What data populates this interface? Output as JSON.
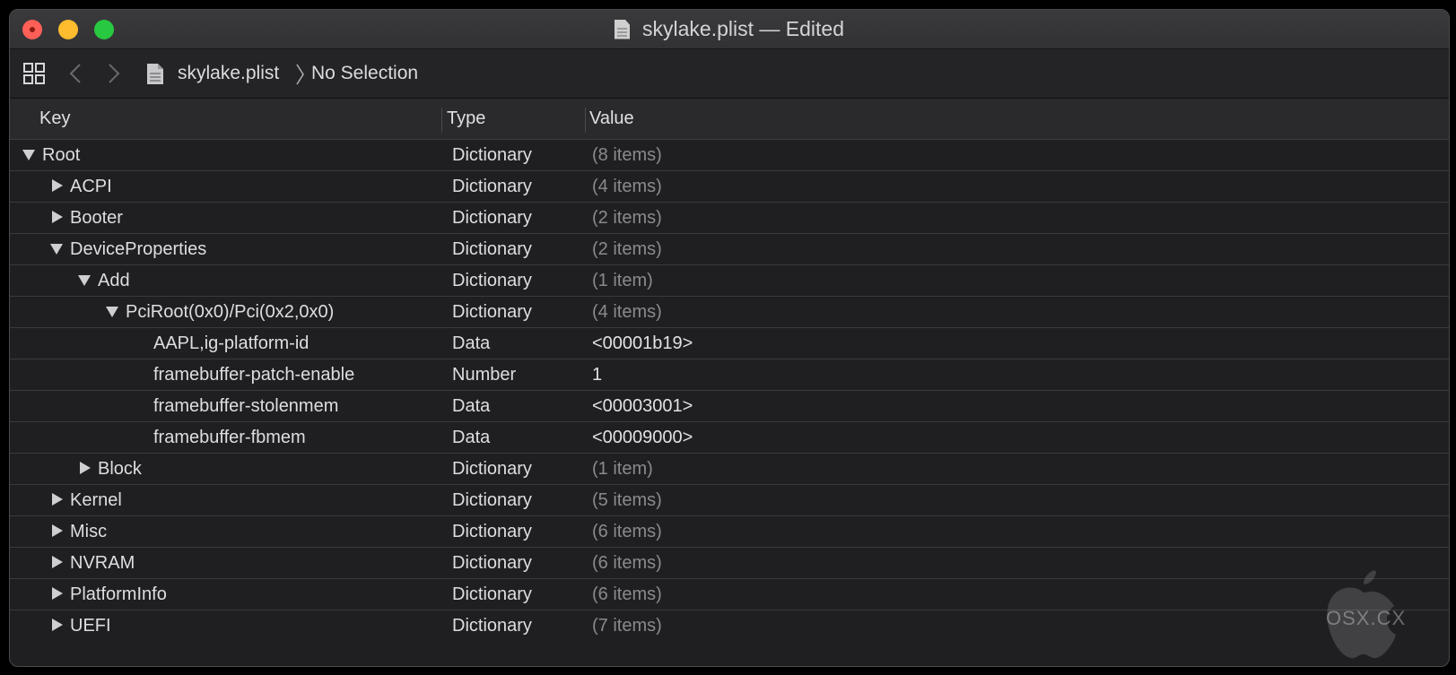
{
  "window": {
    "title": "skylake.plist — Edited"
  },
  "toolbar": {
    "file_name": "skylake.plist",
    "selection": "No Selection"
  },
  "columns": {
    "key": "Key",
    "type": "Type",
    "value": "Value"
  },
  "rows": [
    {
      "key": "Root",
      "depth": 0,
      "disclosure": "expanded",
      "type": "Dictionary",
      "value": "(8 items)",
      "container": true
    },
    {
      "key": "ACPI",
      "depth": 1,
      "disclosure": "collapsed",
      "type": "Dictionary",
      "value": "(4 items)",
      "container": true
    },
    {
      "key": "Booter",
      "depth": 1,
      "disclosure": "collapsed",
      "type": "Dictionary",
      "value": "(2 items)",
      "container": true
    },
    {
      "key": "DeviceProperties",
      "depth": 1,
      "disclosure": "expanded",
      "type": "Dictionary",
      "value": "(2 items)",
      "container": true
    },
    {
      "key": "Add",
      "depth": 2,
      "disclosure": "expanded",
      "type": "Dictionary",
      "value": "(1 item)",
      "container": true
    },
    {
      "key": "PciRoot(0x0)/Pci(0x2,0x0)",
      "depth": 3,
      "disclosure": "expanded",
      "type": "Dictionary",
      "value": "(4 items)",
      "container": true
    },
    {
      "key": "AAPL,ig-platform-id",
      "depth": 4,
      "disclosure": "none",
      "type": "Data",
      "value": "<00001b19>",
      "container": false
    },
    {
      "key": "framebuffer-patch-enable",
      "depth": 4,
      "disclosure": "none",
      "type": "Number",
      "value": "1",
      "container": false
    },
    {
      "key": "framebuffer-stolenmem",
      "depth": 4,
      "disclosure": "none",
      "type": "Data",
      "value": "<00003001>",
      "container": false
    },
    {
      "key": "framebuffer-fbmem",
      "depth": 4,
      "disclosure": "none",
      "type": "Data",
      "value": "<00009000>",
      "container": false
    },
    {
      "key": "Block",
      "depth": 2,
      "disclosure": "collapsed",
      "type": "Dictionary",
      "value": "(1 item)",
      "container": true
    },
    {
      "key": "Kernel",
      "depth": 1,
      "disclosure": "collapsed",
      "type": "Dictionary",
      "value": "(5 items)",
      "container": true
    },
    {
      "key": "Misc",
      "depth": 1,
      "disclosure": "collapsed",
      "type": "Dictionary",
      "value": "(6 items)",
      "container": true
    },
    {
      "key": "NVRAM",
      "depth": 1,
      "disclosure": "collapsed",
      "type": "Dictionary",
      "value": "(6 items)",
      "container": true
    },
    {
      "key": "PlatformInfo",
      "depth": 1,
      "disclosure": "collapsed",
      "type": "Dictionary",
      "value": "(6 items)",
      "container": true
    },
    {
      "key": "UEFI",
      "depth": 1,
      "disclosure": "collapsed",
      "type": "Dictionary",
      "value": "(7 items)",
      "container": true
    }
  ],
  "watermark": {
    "text": "OSX.CX"
  },
  "colors": {
    "close": "#fe5f57",
    "minimize": "#febc2e",
    "zoom": "#28c840",
    "window_bg": "#1f1f21",
    "text": "#dedee0",
    "muted_value": "#8a8a8d"
  }
}
